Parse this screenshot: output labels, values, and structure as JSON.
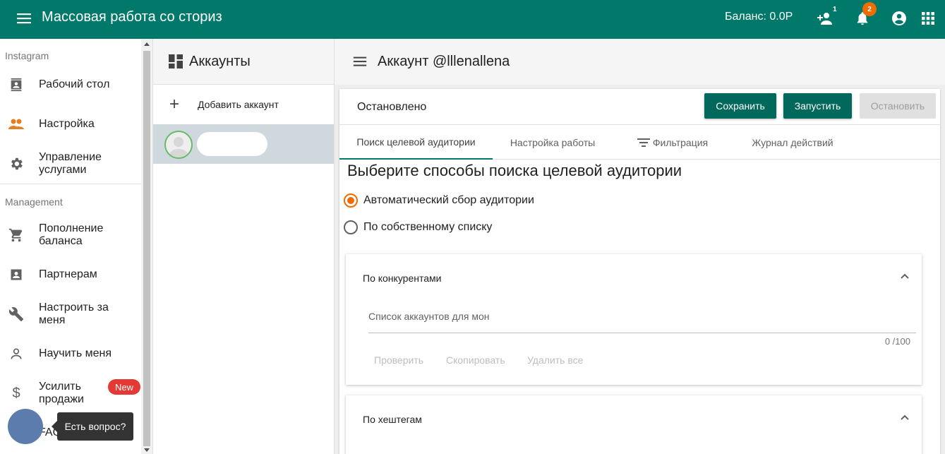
{
  "topbar": {
    "title": "Массовая работа со сториз",
    "balance": "Баланс: 0.0Р",
    "referral_badge": "1",
    "notifications_count": "2",
    "bg_color": "#00796b"
  },
  "sidebar": {
    "section_instagram": "Instagram",
    "instagram_items": [
      {
        "label": "Рабочий стол",
        "icon": "contacts-icon"
      },
      {
        "label": "Настройка",
        "icon": "people-icon"
      },
      {
        "label": "Управление услугами",
        "icon": "gear-icon"
      }
    ],
    "section_management": "Management",
    "management_items": [
      {
        "label": "Пополнение баланса",
        "icon": "cart-icon"
      },
      {
        "label": "Партнерам",
        "icon": "badge-icon"
      },
      {
        "label": "Настроить за меня",
        "icon": "wrench-icon"
      },
      {
        "label": "Научить меня",
        "icon": "person-icon"
      },
      {
        "label": "Усилить продажи",
        "icon": "dollar-icon"
      },
      {
        "label": "FAQ",
        "icon": "faq-icon"
      }
    ],
    "new_badge": "New"
  },
  "chat": {
    "tooltip": "Есть вопрос?"
  },
  "accounts": {
    "title": "Аккаунты",
    "add_label": "Добавить аккаунт"
  },
  "main": {
    "title": "Аккаунт @lllenallena",
    "status": "Остановлено",
    "buttons": {
      "save": "Сохранить",
      "start": "Запустить",
      "stop": "Остановить"
    },
    "tabs": [
      {
        "label": "Поиск целевой аудитории",
        "active": true
      },
      {
        "label": "Настройка работы",
        "active": false
      },
      {
        "label": "Фильтрация",
        "active": false
      },
      {
        "label": "Журнал действий",
        "active": false
      }
    ],
    "content_title": "Выберите способы поиска целевой аудитории",
    "radios": [
      {
        "label": "Автоматический сбор аудитории",
        "checked": true
      },
      {
        "label": "По собственному списку",
        "checked": false
      }
    ],
    "competitors": {
      "header": "По конкурентами",
      "placeholder": "Список аккаунтов для мон",
      "counter": "0 /100",
      "actions": [
        "Проверить",
        "Скопировать",
        "Удалить все"
      ]
    },
    "hashtags": {
      "header": "По хештегам"
    }
  }
}
